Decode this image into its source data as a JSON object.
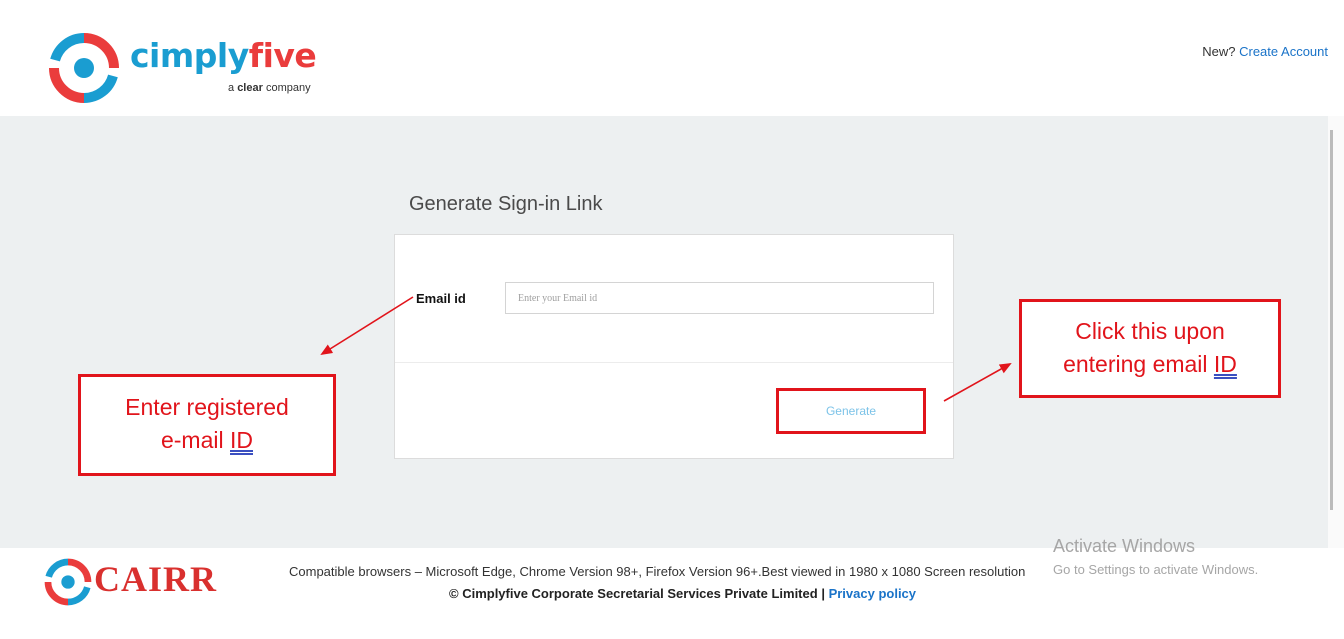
{
  "header": {
    "brand_name_part1": "cimply",
    "brand_name_part2": "five",
    "brand_tagline_prefix": "a",
    "brand_tagline_bold": "clear",
    "brand_tagline_suffix": "company",
    "new_prompt": "New?",
    "create_account_link": "Create Account"
  },
  "form": {
    "title": "Generate Sign-in Link",
    "email_label": "Email id",
    "email_value": "",
    "email_placeholder": "Enter your Email id",
    "generate_button": "Generate"
  },
  "annotations": {
    "left_line1": "Enter registered",
    "left_line2": "e-mail",
    "left_id": "ID",
    "right_line1": "Click this upon",
    "right_line2": "entering email",
    "right_id": "ID"
  },
  "footer": {
    "logo_text": "CAIRR",
    "compat_text": "Compatible browsers – Microsoft Edge, Chrome Version 98+, Firefox Version 96+.Best viewed in 1980 x 1080 Screen resolution",
    "copyright": "© Cimplyfive Corporate Secretarial Services Private Limited",
    "separator": "|",
    "privacy_link": "Privacy policy"
  },
  "watermark": {
    "title": "Activate Windows",
    "subtitle": "Go to Settings to activate Windows."
  },
  "colors": {
    "brand_blue": "#1a9dd1",
    "brand_red": "#ea3c3c",
    "annotation_red": "#e1141b",
    "link_blue": "#1a73c8",
    "page_grey": "#edf0f1"
  }
}
